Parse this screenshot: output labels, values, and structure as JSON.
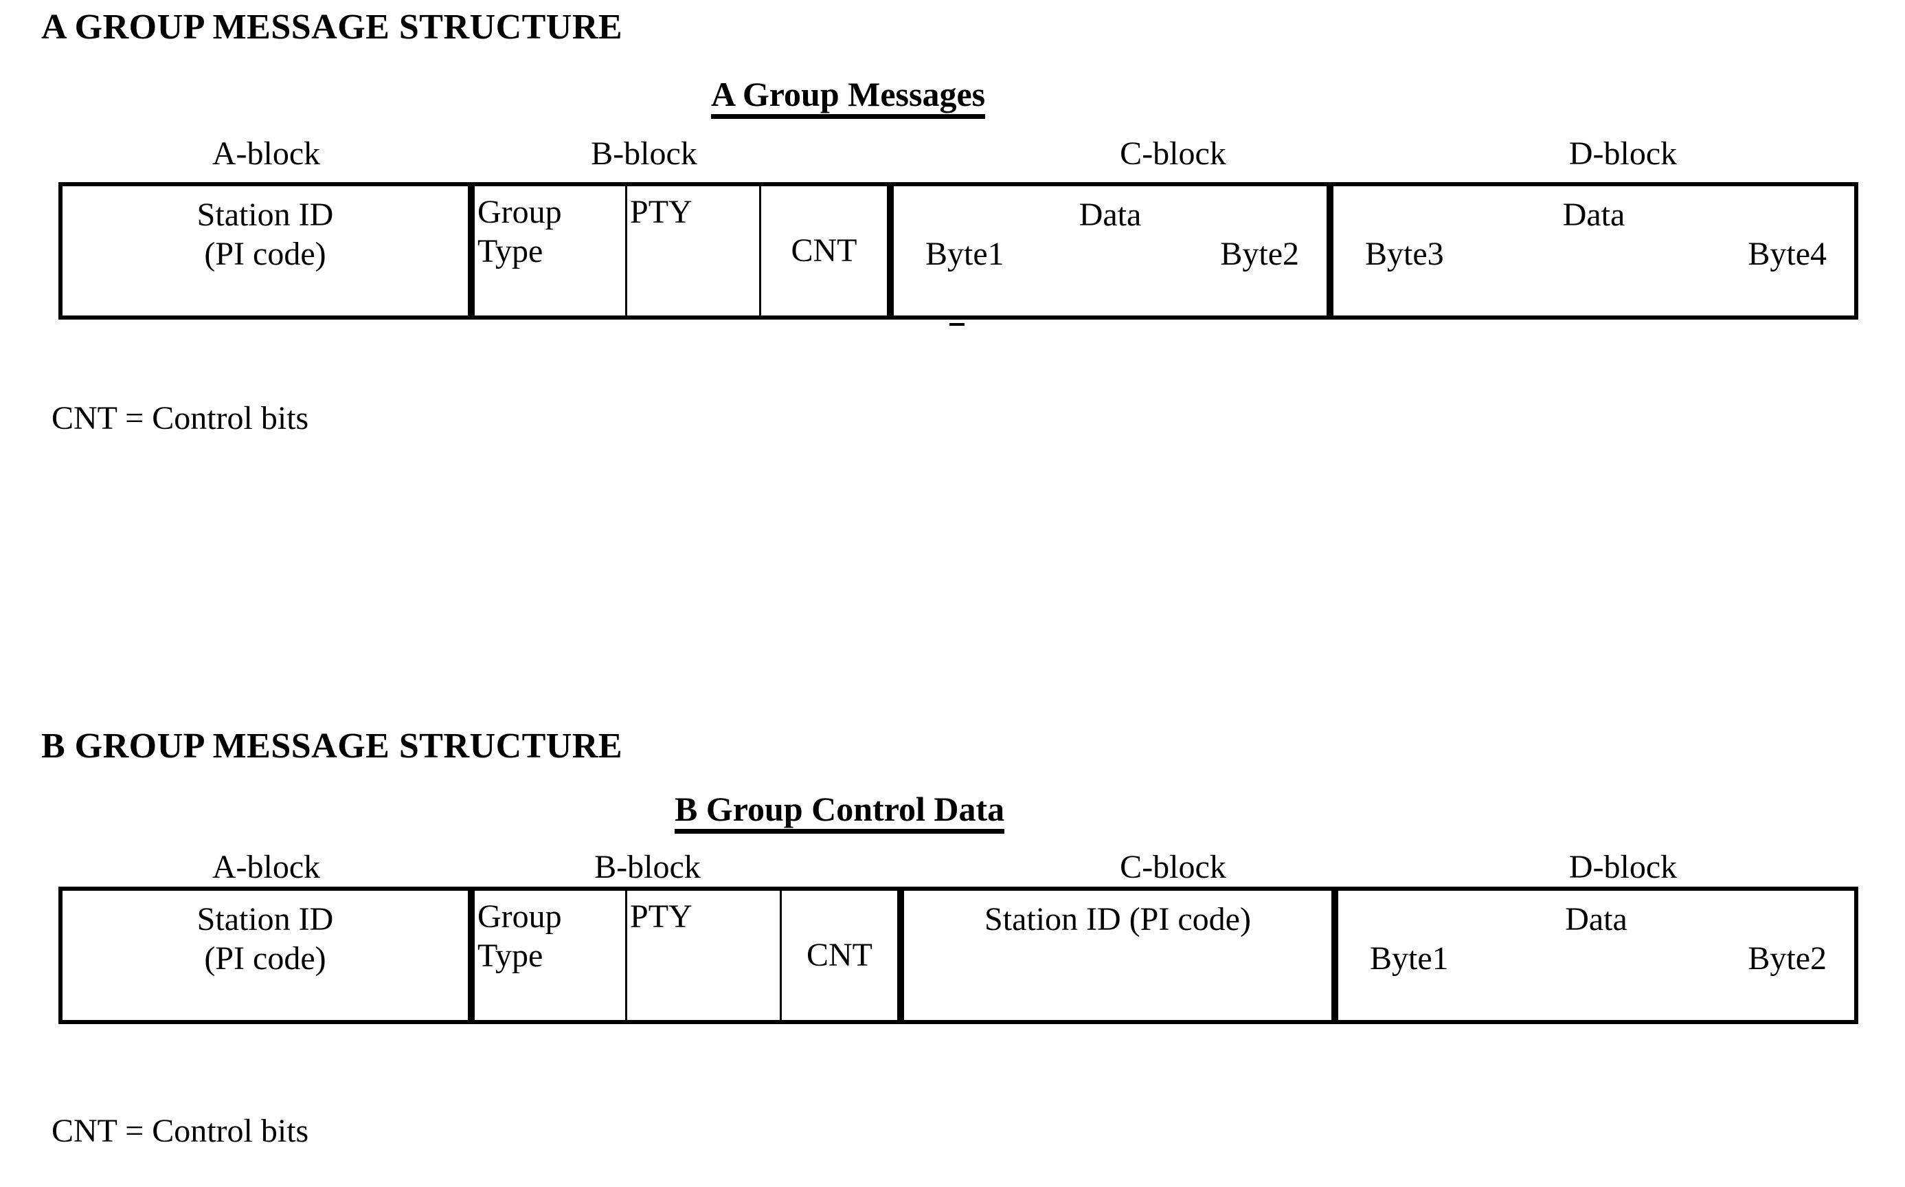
{
  "document": {
    "sections": [
      {
        "heading": "A GROUP MESSAGE STRUCTURE",
        "caption": "A Group Messages",
        "block_labels": [
          "A-block",
          "B-block",
          "C-block",
          "D-block"
        ],
        "cells": [
          {
            "name": "station-id",
            "line1": "Station ID",
            "line2": "(PI code)"
          },
          {
            "name": "group-type",
            "line1": "Group",
            "line2": "Type"
          },
          {
            "name": "pty",
            "line1": "PTY",
            "line2": ""
          },
          {
            "name": "cnt",
            "line1": "CNT",
            "line2": ""
          },
          {
            "name": "c-block-data",
            "line1": "Data",
            "left": "Byte1",
            "right": "Byte2"
          },
          {
            "name": "d-block-data",
            "line1": "Data",
            "left": "Byte3",
            "right": "Byte4"
          }
        ],
        "legend": "CNT = Control bits"
      },
      {
        "heading": "B GROUP MESSAGE STRUCTURE",
        "caption": "B Group Control Data",
        "block_labels": [
          "A-block",
          "B-block",
          "C-block",
          "D-block"
        ],
        "cells": [
          {
            "name": "station-id",
            "line1": "Station ID",
            "line2": "(PI code)"
          },
          {
            "name": "group-type",
            "line1": "Group",
            "line2": "Type"
          },
          {
            "name": "pty",
            "line1": "PTY",
            "line2": ""
          },
          {
            "name": "cnt",
            "line1": "CNT",
            "line2": ""
          },
          {
            "name": "c-block-station-id",
            "line1": "Station ID (PI code)",
            "line2": ""
          },
          {
            "name": "d-block-data",
            "line1": "Data",
            "left": "Byte1",
            "right": "Byte2"
          }
        ],
        "legend": "CNT = Control bits"
      }
    ]
  },
  "colors": {
    "ink": "#000000",
    "paper": "#ffffff"
  }
}
